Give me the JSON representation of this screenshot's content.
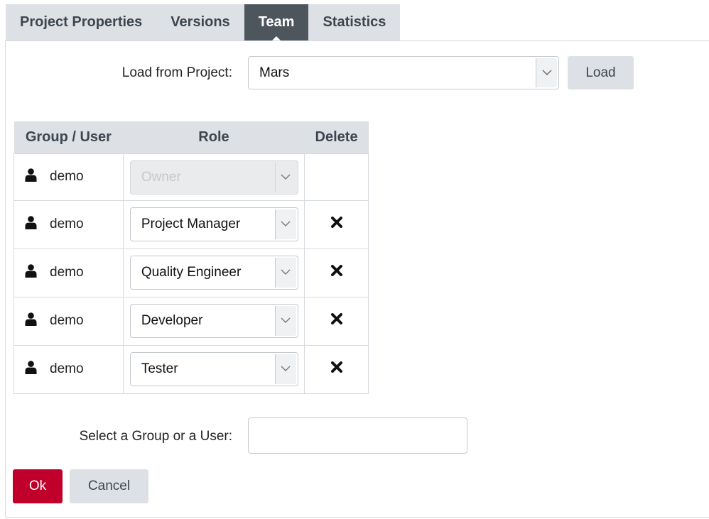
{
  "tabs": [
    {
      "label": "Project Properties",
      "active": false
    },
    {
      "label": "Versions",
      "active": false
    },
    {
      "label": "Team",
      "active": true
    },
    {
      "label": "Statistics",
      "active": false
    }
  ],
  "load": {
    "label": "Load from Project:",
    "selected_project": "Mars",
    "button_label": "Load"
  },
  "team_table": {
    "headers": [
      "Group / User",
      "Role",
      "Delete"
    ],
    "rows": [
      {
        "user": "demo",
        "role": "Owner",
        "role_disabled": true,
        "deletable": false
      },
      {
        "user": "demo",
        "role": "Project Manager",
        "role_disabled": false,
        "deletable": true
      },
      {
        "user": "demo",
        "role": "Quality Engineer",
        "role_disabled": false,
        "deletable": true
      },
      {
        "user": "demo",
        "role": "Developer",
        "role_disabled": false,
        "deletable": true
      },
      {
        "user": "demo",
        "role": "Tester",
        "role_disabled": false,
        "deletable": true
      }
    ]
  },
  "picker": {
    "label": "Select a Group or a User:",
    "value": ""
  },
  "actions": {
    "ok_label": "Ok",
    "cancel_label": "Cancel"
  },
  "icons": {
    "user": "user-icon",
    "delete": "delete-x-icon",
    "caret": "chevron-down-icon"
  },
  "colors": {
    "accent": "#c0002b",
    "tab_active": "#4d555d",
    "tab_inactive": "#dde1e5"
  }
}
